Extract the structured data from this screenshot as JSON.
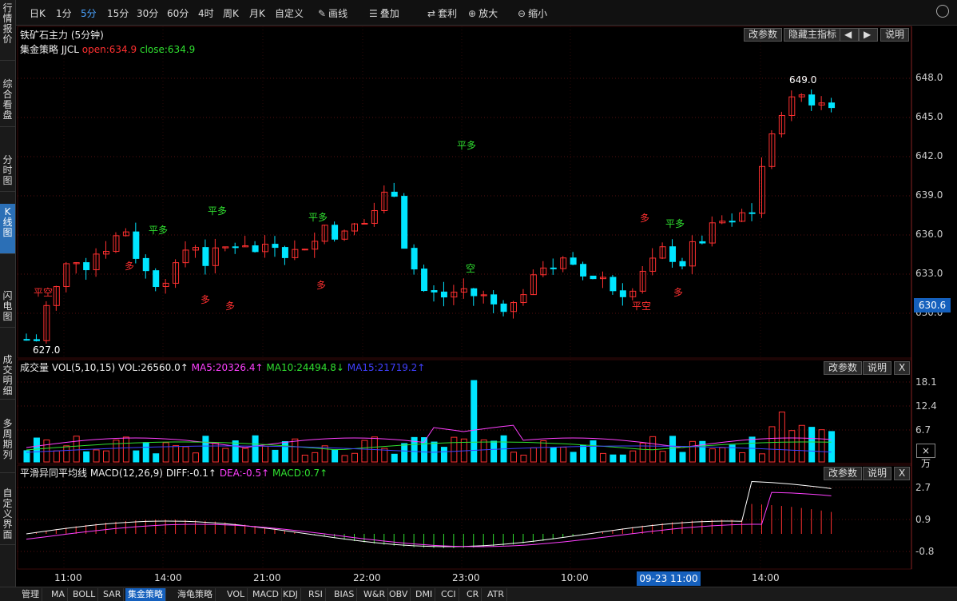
{
  "left_tabs": [
    {
      "label": "行情报价",
      "active": false
    },
    {
      "label": "综合看盘",
      "active": false
    },
    {
      "label": "分时图",
      "active": false
    },
    {
      "label": "K线图",
      "active": true
    },
    {
      "label": "闪电图",
      "active": false
    },
    {
      "label": "成交明细",
      "active": false
    },
    {
      "label": "多周期列",
      "active": false
    },
    {
      "label": "自定义界面",
      "active": false
    }
  ],
  "toolbar": {
    "periods": [
      "日K",
      "1分",
      "5分",
      "15分",
      "30分",
      "60分",
      "4时",
      "周K",
      "月K",
      "自定义"
    ],
    "selected_period": "5分",
    "tools": [
      {
        "label": "画线",
        "icon": "pencil-icon",
        "glyph": "✎"
      },
      {
        "label": "叠加",
        "icon": "stack-icon",
        "glyph": "☰"
      },
      {
        "label": "套利",
        "icon": "arbitrage-icon",
        "glyph": "⇄"
      },
      {
        "label": "放大",
        "icon": "zoom-in-icon",
        "glyph": "⊕"
      },
      {
        "label": "缩小",
        "icon": "zoom-out-icon",
        "glyph": "⊖"
      }
    ]
  },
  "main_panel": {
    "title": "铁矿石主力 (5分钟)",
    "strategy_name": "集金策略 JJCL",
    "open_text": "open:634.9",
    "close_text": "close:634.9",
    "buttons": {
      "params": "改参数",
      "hide": "隐藏主指标",
      "prev": "◀",
      "next": "▶",
      "help": "说明"
    },
    "price_ticks": [
      "648.0",
      "645.0",
      "642.0",
      "639.0",
      "636.0",
      "633.0",
      "630.0"
    ],
    "last_price": "630.6",
    "high_label": "649.0",
    "low_label": "627.0"
  },
  "signals": [
    {
      "text": "平空",
      "color": "#ff3030"
    },
    {
      "text": "平多",
      "color": "#30e030"
    },
    {
      "text": "多",
      "color": "#ff3030"
    },
    {
      "text": "空",
      "color": "#30e030"
    },
    {
      "text": "平空",
      "color": "#ff3030"
    }
  ],
  "volume_panel": {
    "title": "成交量",
    "vol_text": "VOL(5,10,15)",
    "vol_value": "VOL:26560.0↑",
    "ma5": "MA5:20326.4↑",
    "ma10": "MA10:24494.8↓",
    "ma15": "MA15:21719.2↑",
    "ticks": [
      "18.1",
      "12.4",
      "6.7"
    ],
    "unit": "×万",
    "buttons": {
      "params": "改参数",
      "help": "说明",
      "close": "X"
    }
  },
  "macd_panel": {
    "title": "平滑异同平均线",
    "macd_text": "MACD(12,26,9)",
    "diff": "DIFF:-0.1↑",
    "dea": "DEA:-0.5↑",
    "macd": "MACD:0.7↑",
    "ticks": [
      "2.7",
      "0.9",
      "-0.8"
    ],
    "buttons": {
      "params": "改参数",
      "help": "说明",
      "close": "X"
    }
  },
  "time_axis": {
    "labels": [
      "11:00",
      "14:00",
      "21:00",
      "22:00",
      "23:00",
      "10:00",
      "14:00"
    ],
    "cursor_time": "09-23 11:00"
  },
  "bottom_tabs": [
    {
      "label": "管理",
      "active": false
    },
    {
      "label": "MA",
      "active": false
    },
    {
      "label": "BOLL",
      "active": false
    },
    {
      "label": "SAR",
      "active": false
    },
    {
      "label": "集金策略",
      "active": true
    },
    {
      "label": "海龟策略",
      "active": false
    },
    {
      "label": "VOL",
      "active": false
    },
    {
      "label": "MACD",
      "active": false
    },
    {
      "label": "KDJ",
      "active": false
    },
    {
      "label": "RSI",
      "active": false
    },
    {
      "label": "BIAS",
      "active": false
    },
    {
      "label": "W&R",
      "active": false
    },
    {
      "label": "OBV",
      "active": false
    },
    {
      "label": "DMI",
      "active": false
    },
    {
      "label": "CCI",
      "active": false
    },
    {
      "label": "CR",
      "active": false
    },
    {
      "label": "ATR",
      "active": false
    }
  ],
  "colors": {
    "up": "#ff3030",
    "down": "#00e5ff",
    "ma5": "#ff40ff",
    "ma10": "#30e030",
    "ma15": "#4040ff",
    "grid": "#551111",
    "accent": "#1560bd"
  }
}
